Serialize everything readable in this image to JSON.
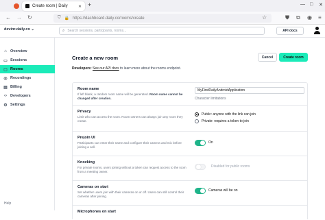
{
  "browser": {
    "tab_title": "Create room | Daily",
    "url": "https://dashboard.daily.co/rooms/create"
  },
  "header": {
    "workspace": "devinr.daily.co",
    "search_placeholder": "Search sessions, participants, rooms...",
    "api_docs": "API docs"
  },
  "sidebar": {
    "items": [
      {
        "label": "Overview",
        "icon": "overview-icon"
      },
      {
        "label": "Sessions",
        "icon": "sessions-icon"
      },
      {
        "label": "Rooms",
        "icon": "rooms-icon",
        "active": true
      },
      {
        "label": "Recordings",
        "icon": "recordings-icon"
      },
      {
        "label": "Billing",
        "icon": "billing-icon"
      },
      {
        "label": "Developers",
        "icon": "developers-icon"
      },
      {
        "label": "Settings",
        "icon": "settings-icon"
      }
    ],
    "help": "Help"
  },
  "main": {
    "title": "Create a new room",
    "cancel": "Cancel",
    "create": "Create room",
    "dev_label": "Developers:",
    "dev_link": "See our API docs",
    "dev_rest": "to learn more about the rooms endpoint."
  },
  "form": {
    "room_name": {
      "label": "Room name",
      "desc1": "If left blank, a random room name will be generated.",
      "desc_bold": "Room name cannot be changed after creation.",
      "value": "MyFirstDailyAndroidApplication",
      "limits": "Character limitations"
    },
    "privacy": {
      "label": "Privacy",
      "desc": "Limit who can access the room. Room owners can always join any room they create.",
      "public": "Public: anyone with the link can join",
      "private": "Private: requires a token to join"
    },
    "prejoin": {
      "label": "Prejoin UI",
      "desc": "Participants can enter their name and configure their camera and mic before joining a call.",
      "state": "On"
    },
    "knocking": {
      "label": "Knocking",
      "desc": "For private rooms, users joining without a token can request access to the room from a meeting owner.",
      "state": "Disabled for public rooms"
    },
    "cameras": {
      "label": "Cameras on start",
      "desc": "Set whether users join with their cameras on or off. Users can still control their cameras after joining.",
      "state": "Cameras will be on"
    },
    "mics": {
      "label": "Microphones on start"
    }
  },
  "colors": {
    "accent": "#1bebb9",
    "toggle_on": "#1fb48a"
  }
}
